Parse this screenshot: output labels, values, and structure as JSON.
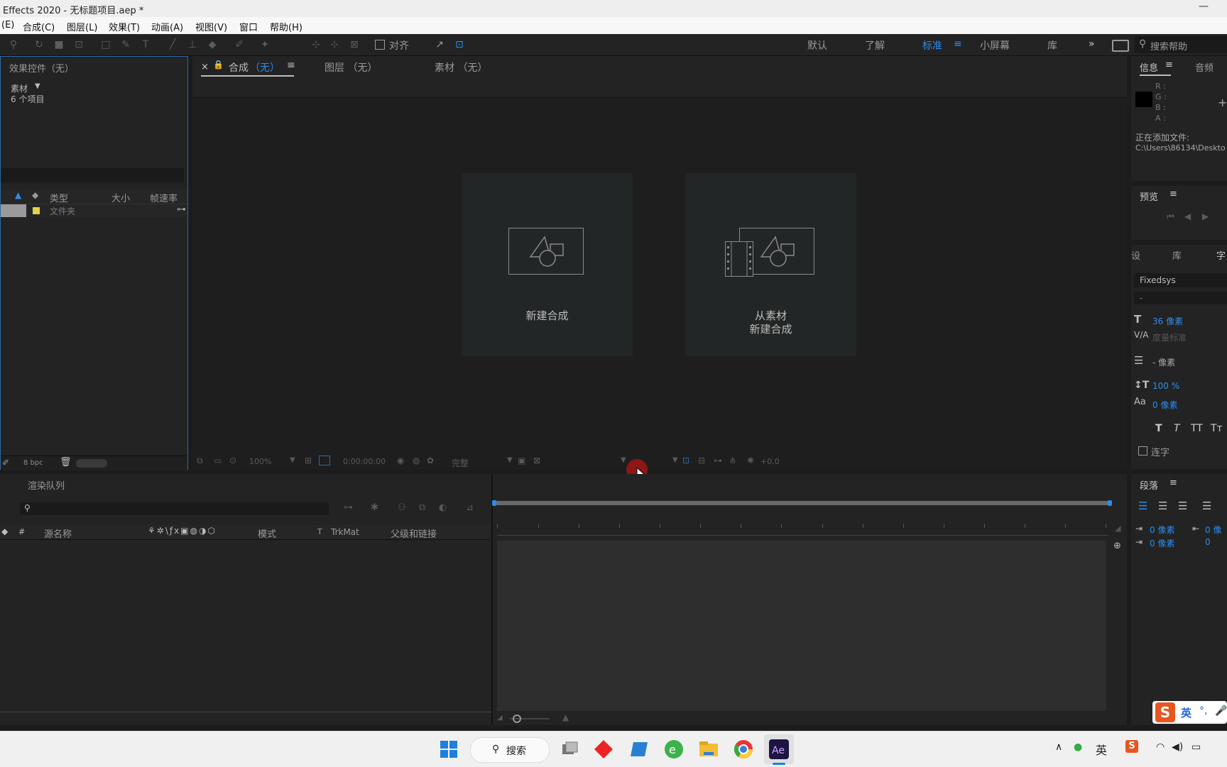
{
  "window": {
    "title": "Effects 2020 - 无标题项目.aep *",
    "minimize": "—"
  },
  "menu": [
    "(E)",
    "合成(C)",
    "图层(L)",
    "效果(T)",
    "动画(A)",
    "视图(V)",
    "窗口",
    "帮助(H)"
  ],
  "toolbar": {
    "align_label": "对齐"
  },
  "workspaces": {
    "items": [
      "默认",
      "了解",
      "标准",
      "小屏幕",
      "库"
    ],
    "active": "标准",
    "more": "»",
    "search_placeholder": "搜索帮助"
  },
  "project_panel": {
    "title": "效果控件（无）",
    "footage_label": "素材",
    "item_count": "6 个项目",
    "columns": [
      "类型",
      "大小",
      "帧速率"
    ],
    "row_type": "文件夹",
    "bpc": "8 bpc"
  },
  "viewer": {
    "tabs": [
      "合成",
      "（无）",
      "图层 （无）",
      "素材 （无）"
    ],
    "close": "×",
    "new_comp_label": "新建合成",
    "from_footage_line1": "从素材",
    "from_footage_line2": "新建合成",
    "zoom": "100%",
    "timecode": "0:00:00:00",
    "resolution": "完整",
    "exposure": "+0.0"
  },
  "timeline": {
    "title": "渲染队列",
    "columns": {
      "num": "#",
      "source": "源名称",
      "mode": "模式",
      "t": "T",
      "trkmat": "TrkMat",
      "parent": "父级和链接"
    }
  },
  "info_panel": {
    "tabs": [
      "信息",
      "音频"
    ],
    "rgba": [
      "R :",
      "G :",
      "B :",
      "A :"
    ],
    "status_line1": "正在添加文件:",
    "status_line2": "C:\\Users\\86134\\Deskto"
  },
  "preview_panel": {
    "title": "预览"
  },
  "character_panel": {
    "tabs": [
      "设",
      "库",
      "字"
    ],
    "font": "Fixedsys",
    "style": "-",
    "size": "36 像素",
    "tracking": "度量标准",
    "leading": "- 像素",
    "vscale": "100 %",
    "baseline": "0 像素",
    "ligature": "连字"
  },
  "paragraph_panel": {
    "title": "段落",
    "indent1": "0 像素",
    "indent2": "0 像素",
    "indent3": "0 像"
  },
  "taskbar": {
    "search": "搜索",
    "ime": "英",
    "ime_float": "英"
  }
}
